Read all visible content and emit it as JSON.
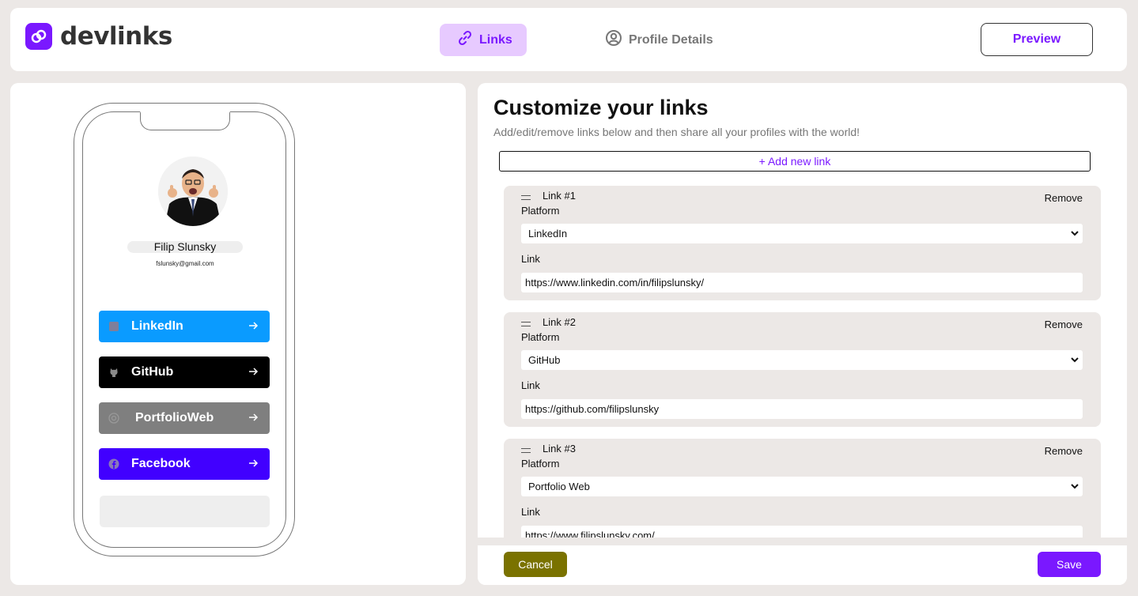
{
  "header": {
    "logo_text": "devlinks",
    "tabs": [
      {
        "label": "Links",
        "icon": "link-icon",
        "active": true
      },
      {
        "label": "Profile Details",
        "icon": "user-circle-icon",
        "active": false
      }
    ],
    "preview_label": "Preview"
  },
  "colors": {
    "accent": "#7a18ff",
    "accent_light": "#e7caff",
    "linkedin": "#0a9bff",
    "github": "#000000",
    "portfolio": "#7f7f7f",
    "facebook": "#4100ff",
    "cancel": "#7a7200"
  },
  "preview": {
    "name": "Filip Slunsky",
    "email": "fslunsky@gmail.com",
    "links": [
      {
        "label": "LinkedIn",
        "icon": "linkedin-icon"
      },
      {
        "label": "GitHub",
        "icon": "github-icon"
      },
      {
        "label": "PortfolioWeb",
        "icon": "globe-icon"
      },
      {
        "label": "Facebook",
        "icon": "facebook-icon"
      }
    ]
  },
  "editor": {
    "title": "Customize your links",
    "subtitle": "Add/edit/remove links below and then share all your profiles with the world!",
    "add_label": "+ Add new link",
    "platform_label": "Platform",
    "link_label": "Link",
    "remove_label": "Remove",
    "cards": [
      {
        "title": "Link #1",
        "platform": "LinkedIn",
        "url": "https://www.linkedin.com/in/filipslunsky/"
      },
      {
        "title": "Link #2",
        "platform": "GitHub",
        "url": "https://github.com/filipslunsky"
      },
      {
        "title": "Link #3",
        "platform": "Portfolio Web",
        "url": "https://www.filipslunsky.com/"
      }
    ]
  },
  "footer": {
    "cancel_label": "Cancel",
    "save_label": "Save"
  }
}
